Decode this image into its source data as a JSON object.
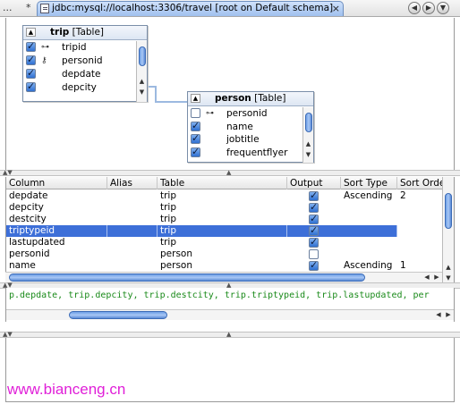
{
  "tabs": {
    "prev_label": "...",
    "prev_marker": "*",
    "active_label": "jdbc:mysql://localhost:3306/travel [root on Default schema]",
    "close_glyph": "×",
    "nav": [
      "◀",
      "▶",
      "▼"
    ]
  },
  "diagram": {
    "trip": {
      "name": "trip",
      "kind": "[Table]",
      "columns": [
        {
          "name": "tripid",
          "checked": true,
          "icon": "primary-key-icon"
        },
        {
          "name": "personid",
          "checked": true,
          "icon": "foreign-key-icon"
        },
        {
          "name": "depdate",
          "checked": true,
          "icon": ""
        },
        {
          "name": "depcity",
          "checked": true,
          "icon": ""
        }
      ]
    },
    "person": {
      "name": "person",
      "kind": "[Table]",
      "columns": [
        {
          "name": "personid",
          "checked": false,
          "icon": "primary-key-icon"
        },
        {
          "name": "name",
          "checked": true,
          "icon": ""
        },
        {
          "name": "jobtitle",
          "checked": true,
          "icon": ""
        },
        {
          "name": "frequentflyer",
          "checked": true,
          "icon": ""
        }
      ]
    }
  },
  "grid": {
    "headers": [
      "Column",
      "Alias",
      "Table",
      "Output",
      "Sort Type",
      "Sort Order"
    ],
    "rows": [
      {
        "column": "depdate",
        "alias": "",
        "table": "trip",
        "output": true,
        "sort_type": "Ascending",
        "sort_order": "2",
        "selected": false
      },
      {
        "column": "depcity",
        "alias": "",
        "table": "trip",
        "output": true,
        "sort_type": "",
        "sort_order": "",
        "selected": false
      },
      {
        "column": "destcity",
        "alias": "",
        "table": "trip",
        "output": true,
        "sort_type": "",
        "sort_order": "",
        "selected": false
      },
      {
        "column": "triptypeid",
        "alias": "",
        "table": "trip",
        "output": true,
        "sort_type": "",
        "sort_order": "",
        "selected": true
      },
      {
        "column": "lastupdated",
        "alias": "",
        "table": "trip",
        "output": true,
        "sort_type": "",
        "sort_order": "",
        "selected": false
      },
      {
        "column": "personid",
        "alias": "",
        "table": "person",
        "output": false,
        "sort_type": "",
        "sort_order": "",
        "selected": false
      },
      {
        "column": "name",
        "alias": "",
        "table": "person",
        "output": true,
        "sort_type": "Ascending",
        "sort_order": "1",
        "selected": false
      }
    ]
  },
  "sql": {
    "text": "p.depdate, trip.depcity, trip.destcity, trip.triptypeid, trip.lastupdated, per"
  },
  "watermark": "www.bianceng.cn",
  "colors": {
    "selection": "#3d6fd8",
    "sql_text": "#1a8a1a",
    "watermark": "#e020d8",
    "scroll_thumb": "#6c9ee6"
  }
}
